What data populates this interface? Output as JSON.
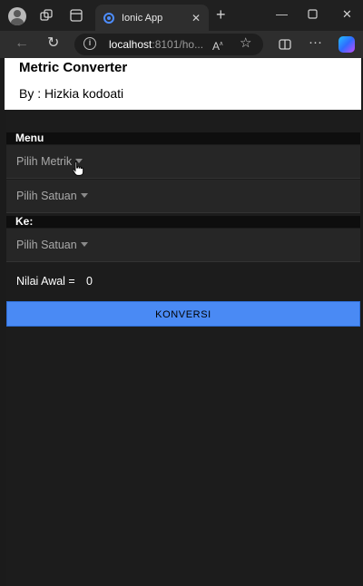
{
  "browser": {
    "tab_title": "Ionic App",
    "url_host": "localhost",
    "url_rest": ":8101/ho..."
  },
  "app": {
    "title": "Metric Converter",
    "subtitle": "By : Hizkia kodoati"
  },
  "form": {
    "menu_label": "Menu",
    "metric_select": "Pilih Metrik",
    "from_unit_select": "Pilih Satuan",
    "to_label": "Ke:",
    "to_unit_select": "Pilih Satuan",
    "initial_value_label": "Nilai Awal =",
    "initial_value": "0",
    "convert_button": "KONVERSI"
  }
}
